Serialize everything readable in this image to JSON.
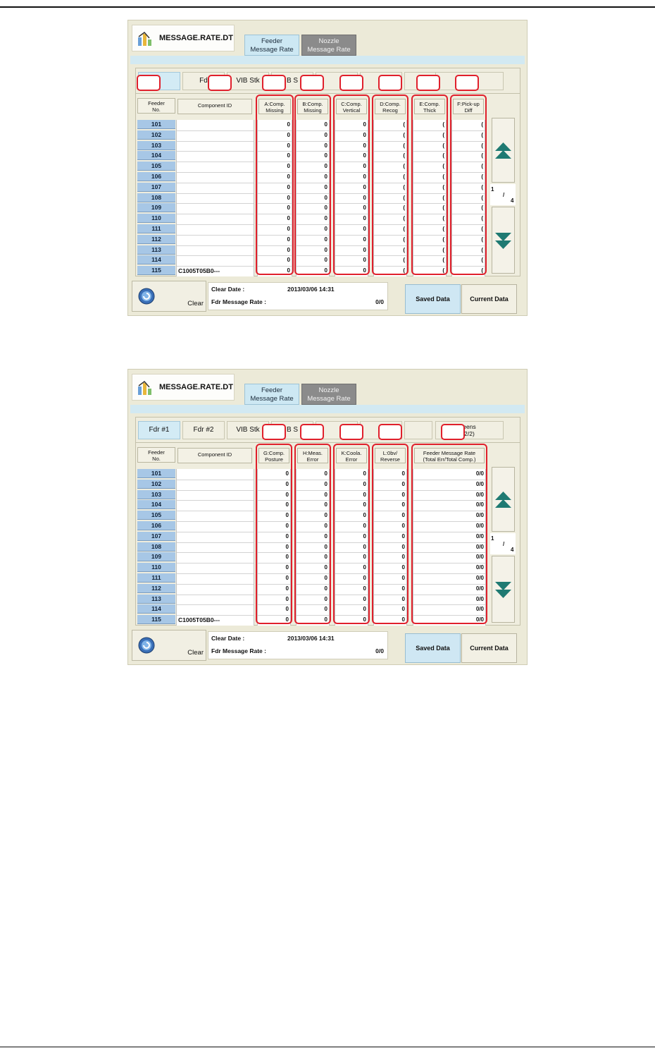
{
  "app": {
    "title": "MESSAGE.RATE.DT",
    "tab_feeder": "Feeder\nMessage Rate",
    "tab_nozzle": "Nozzle\nMessage Rate"
  },
  "screen1": {
    "subtabs": [
      "",
      "Fd",
      "VIB Stk",
      "B S",
      "",
      "",
      "",
      "",
      ""
    ],
    "columns": [
      "A:Comp.\nMissing",
      "B:Comp.\nMissing",
      "C:Comp.\nVertical",
      "D:Comp.\nRecog",
      "E:Comp.\nThick",
      "F:Pick-up\nDiff"
    ],
    "values_shown": [
      "0",
      "0",
      "0",
      "(",
      "(",
      "("
    ]
  },
  "screen2": {
    "subtabs": [
      "Fdr #1",
      "Fdr #2",
      "VIB Stk",
      "B S",
      "",
      "",
      "",
      "eens\n2/2)"
    ],
    "columns": [
      "G:Comp.\nPosture",
      "H:Meas.\nError",
      "K:Coola.\nError",
      "L:0bv/\nReverse",
      "Feeder Message Rate\n(Total Err/Total Comp.)"
    ],
    "values_shown": [
      "0",
      "0",
      "0",
      "0",
      "0/0"
    ]
  },
  "common": {
    "feeder_no_header": "Feeder\nNo.",
    "component_id_header": "Component ID",
    "feeder_numbers": [
      "101",
      "102",
      "103",
      "104",
      "105",
      "106",
      "107",
      "108",
      "109",
      "110",
      "111",
      "112",
      "113",
      "114",
      "115"
    ],
    "component_id_row_115": "C1005T05B0---",
    "page_current": "1",
    "page_separator": "/",
    "page_total": "4",
    "clear_label": "Clear",
    "clear_date_label": "Clear Date :",
    "clear_date_value": "2013/03/06 14:31",
    "fdr_message_rate_label": "Fdr Message Rate :",
    "fdr_message_rate_value": "0/0",
    "saved_data_label": "Saved Data",
    "current_data_label": "Current Data"
  },
  "colors": {
    "highlight": "#e0202c",
    "feeder_cell": "#a7c7e6",
    "selected_tab": "#cde8f3",
    "panel_bg": "#ecead8",
    "scroll_arrow": "#1f7a72"
  }
}
